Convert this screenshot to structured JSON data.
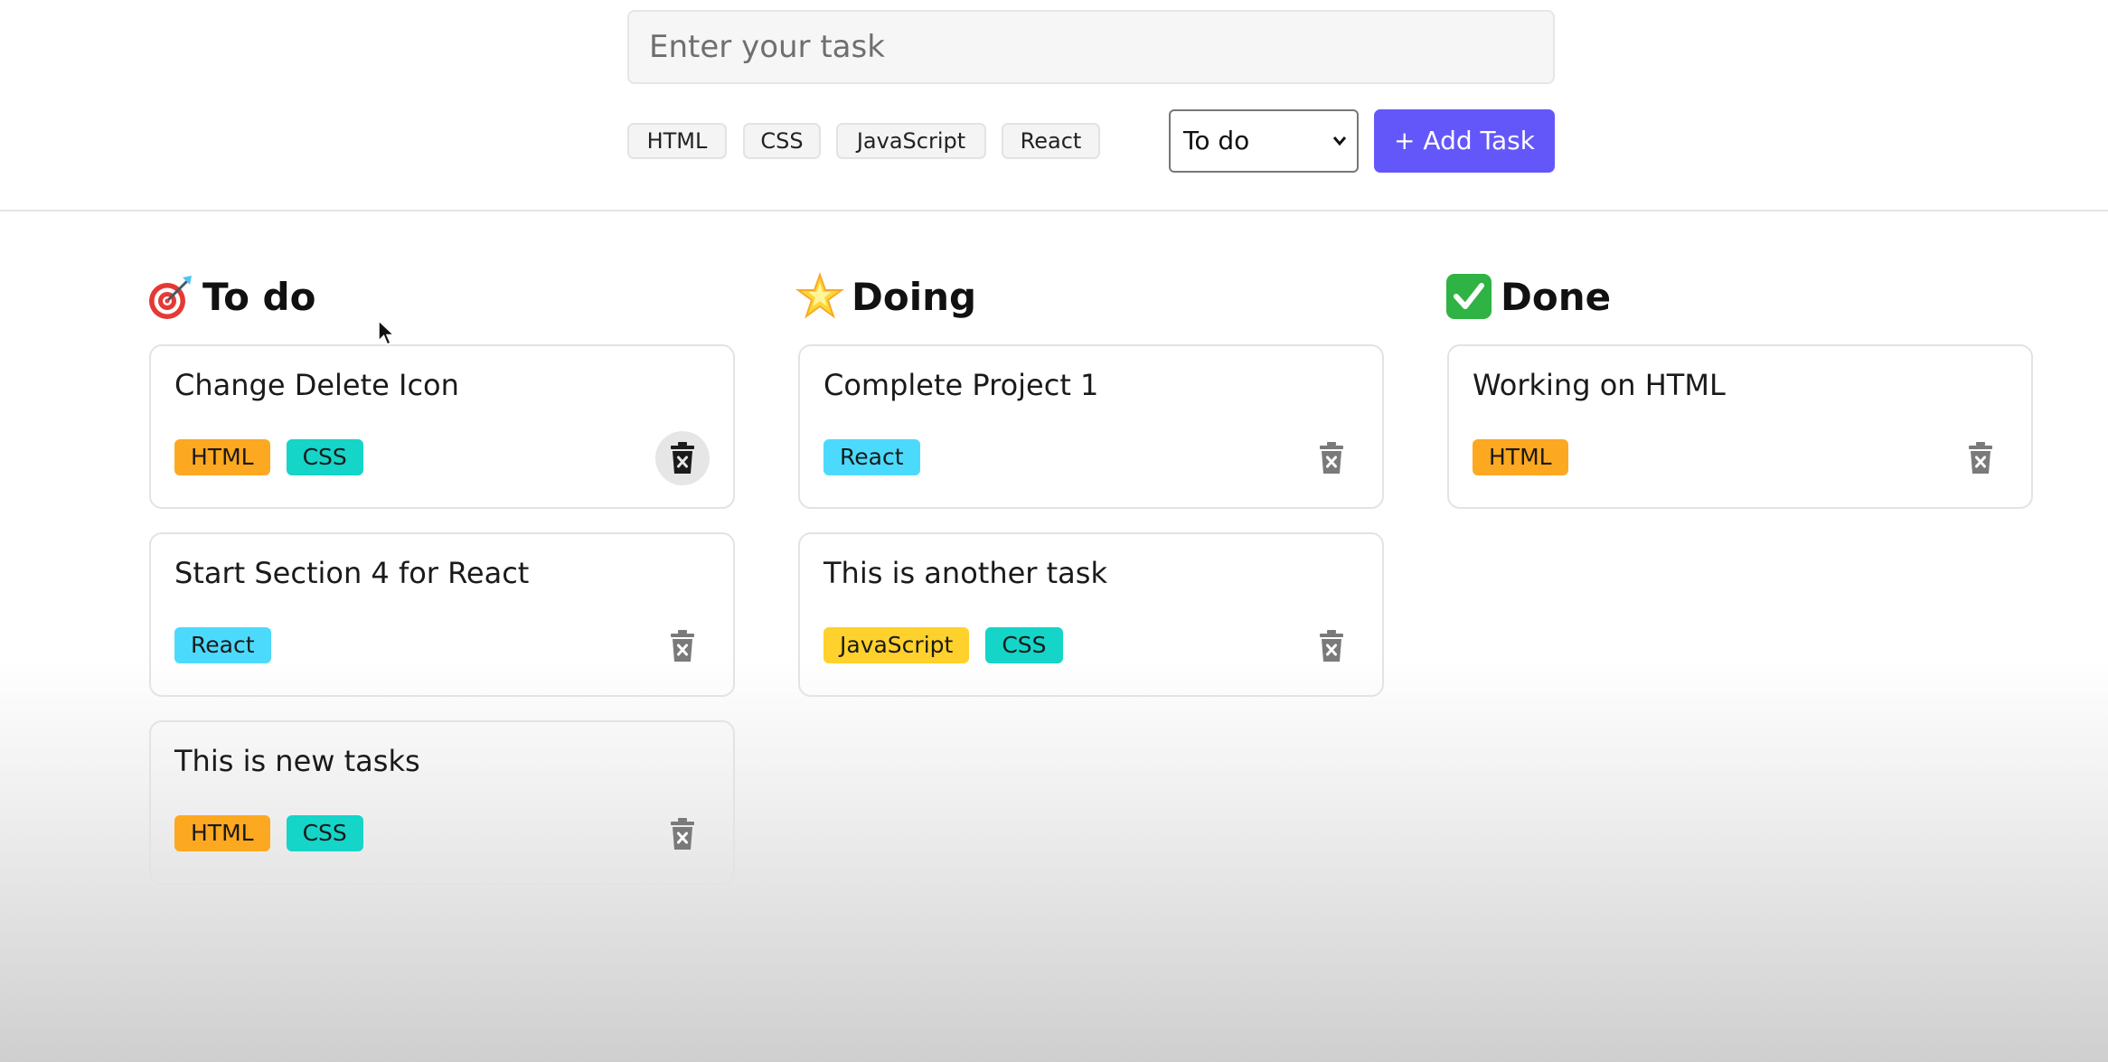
{
  "input": {
    "placeholder": "Enter your task"
  },
  "tag_options": [
    "HTML",
    "CSS",
    "JavaScript",
    "React"
  ],
  "status_select": {
    "value": "To do",
    "options": [
      "To do"
    ]
  },
  "add_button": {
    "label": "+ Add Task"
  },
  "tag_colors": {
    "HTML": "#fda821",
    "CSS": "#15d4c8",
    "JavaScript": "#ffd12c",
    "React": "#4cdafc"
  },
  "columns": [
    {
      "icon": "dart-target-icon",
      "title": "To do",
      "cards": [
        {
          "title": "Change Delete Icon",
          "tags": [
            "HTML",
            "CSS"
          ]
        },
        {
          "title": "Start Section 4 for React",
          "tags": [
            "React"
          ]
        },
        {
          "title": "This is new tasks",
          "tags": [
            "HTML",
            "CSS"
          ]
        }
      ]
    },
    {
      "icon": "glowing-star-icon",
      "title": "Doing",
      "cards": [
        {
          "title": "Complete Project 1",
          "tags": [
            "React"
          ]
        },
        {
          "title": "This is another task",
          "tags": [
            "JavaScript",
            "CSS"
          ]
        }
      ]
    },
    {
      "icon": "check-mark-icon",
      "title": "Done",
      "cards": [
        {
          "title": "Working on HTML",
          "tags": [
            "HTML"
          ]
        }
      ]
    }
  ]
}
